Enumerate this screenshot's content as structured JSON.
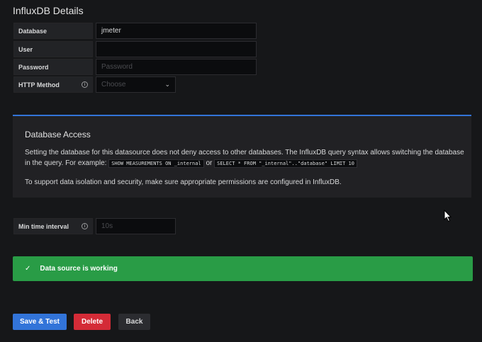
{
  "section_title": "InfluxDB Details",
  "fields": {
    "database": {
      "label": "Database",
      "value": "jmeter"
    },
    "user": {
      "label": "User",
      "value": ""
    },
    "password": {
      "label": "Password",
      "placeholder": "Password"
    },
    "http_method": {
      "label": "HTTP Method",
      "placeholder": "Choose"
    }
  },
  "panel": {
    "title": "Database Access",
    "text_before": "Setting the database for this datasource does not deny access to other databases. The InfluxDB query syntax allows switching the database in the query. For example:",
    "code1": "SHOW MEASUREMENTS ON _internal",
    "or": "or",
    "code2": "SELECT * FROM \"_internal\"..\"database\" LIMIT 10",
    "text2": "To support data isolation and security, make sure appropriate permissions are configured in InfluxDB."
  },
  "min_interval": {
    "label": "Min time interval",
    "placeholder": "10s"
  },
  "alert": {
    "text": "Data source is working"
  },
  "buttons": {
    "save": "Save & Test",
    "delete": "Delete",
    "back": "Back"
  }
}
